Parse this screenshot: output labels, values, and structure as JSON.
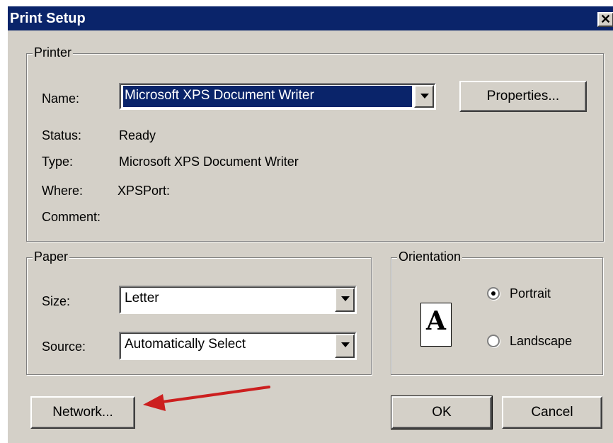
{
  "window": {
    "title": "Print Setup",
    "close_glyph": "✕"
  },
  "printer": {
    "group_label": "Printer",
    "name_label": "Name:",
    "name_value": "Microsoft XPS Document Writer",
    "properties_button": "Properties...",
    "status_label": "Status:",
    "status_value": "Ready",
    "type_label": "Type:",
    "type_value": "Microsoft XPS Document Writer",
    "where_label": "Where:",
    "where_value": "XPSPort:",
    "comment_label": "Comment:"
  },
  "paper": {
    "group_label": "Paper",
    "size_label": "Size:",
    "size_value": "Letter",
    "source_label": "Source:",
    "source_value": "Automatically Select"
  },
  "orientation": {
    "group_label": "Orientation",
    "icon_letter": "A",
    "portrait_label": "Portrait",
    "landscape_label": "Landscape",
    "selected": "Portrait"
  },
  "buttons": {
    "network": "Network...",
    "ok": "OK",
    "cancel": "Cancel"
  },
  "annotation": {
    "arrow_color": "#cc1f1f",
    "points_to": "Network..."
  },
  "colors": {
    "titlebar": "#0a246a",
    "face": "#d4d0c8",
    "selection": "#0a246a"
  }
}
